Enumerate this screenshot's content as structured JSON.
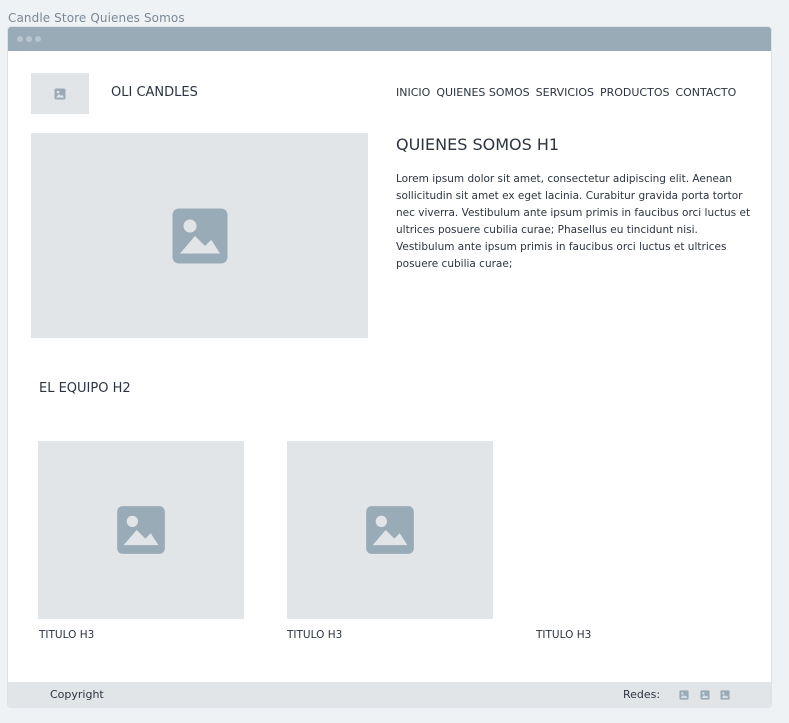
{
  "page_title": "Candle Store Quienes Somos",
  "header": {
    "logo_text": "OLI CANDLES",
    "nav": [
      "INICIO",
      "QUIENES SOMOS",
      "SERVICIOS",
      "PRODUCTOS",
      "CONTACTO"
    ]
  },
  "main": {
    "heading": "QUIENES SOMOS H1",
    "intro": "Lorem ipsum dolor sit amet, consectetur adipiscing elit. Aenean sollicitudin sit amet ex eget lacinia. Curabitur gravida porta tortor nec viverra. Vestibulum ante ipsum primis in faucibus orci luctus et ultrices posuere cubilia curae; Phasellus eu tincidunt nisi. Vestibulum ante ipsum primis in faucibus orci luctus et ultrices posuere cubilia curae;"
  },
  "team": {
    "heading": "EL EQUIPO H2",
    "members": [
      {
        "title": "TITULO  H3"
      },
      {
        "title": "TITULO  H3"
      },
      {
        "title": "TITULO  H3"
      }
    ]
  },
  "footer": {
    "copyright": "Copyright",
    "redes_label": "Redes:",
    "social_icons": [
      "image-icon",
      "image-icon",
      "image-icon"
    ]
  },
  "colors": {
    "titlebar": "#9aabb8",
    "placeholder_bg": "#e2e5e8",
    "placeholder_icon": "#9aabb8",
    "text": "#2b3440"
  }
}
